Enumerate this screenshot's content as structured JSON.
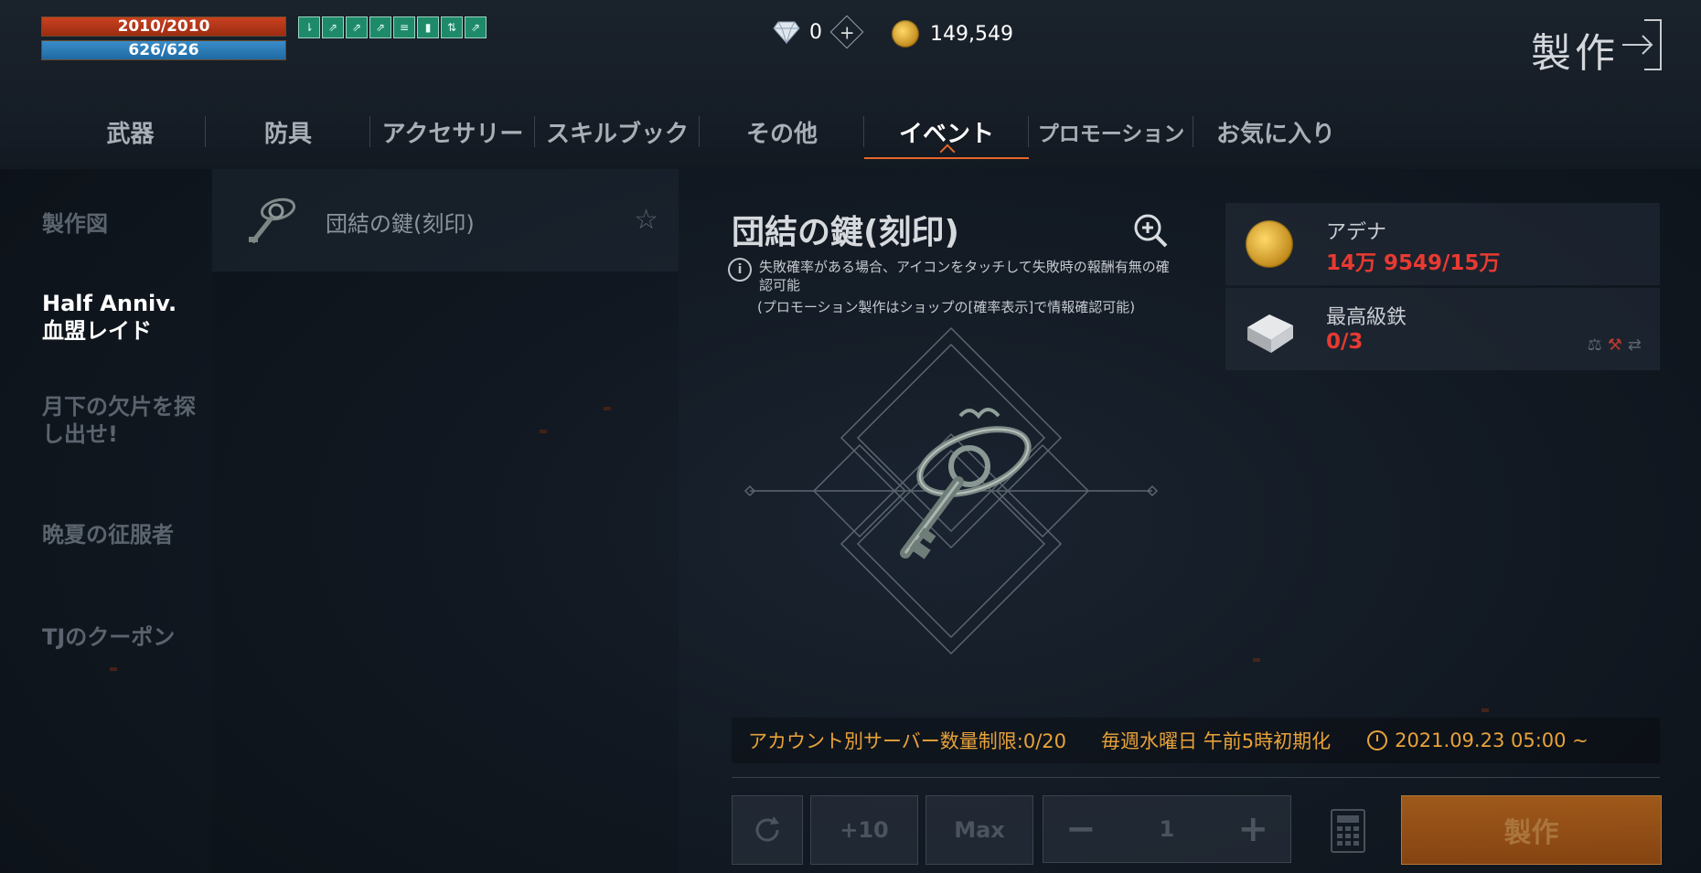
{
  "status": {
    "hp": "2010/2010",
    "mp": "626/626",
    "buffs": [
      "⇂",
      "⇗",
      "⇗",
      "⇗",
      "≡",
      "▮",
      "⇅",
      "⇗"
    ]
  },
  "currency": {
    "gems": "0",
    "adena": "149,549"
  },
  "header": {
    "title": "製作"
  },
  "tabs": [
    {
      "label": "武器"
    },
    {
      "label": "防具"
    },
    {
      "label": "アクセサリー"
    },
    {
      "label": "スキルブック"
    },
    {
      "label": "その他"
    },
    {
      "label": "イベント"
    },
    {
      "label": "プロモーション"
    },
    {
      "label": "お気に入り"
    }
  ],
  "sidebar": {
    "items": [
      {
        "label": "製作図"
      },
      {
        "label": "Half Anniv.\n血盟レイド"
      },
      {
        "label": "月下の欠片を探\nし出せ!"
      },
      {
        "label": "晩夏の征服者"
      },
      {
        "label": "TJのクーポン"
      }
    ]
  },
  "list": {
    "items": [
      {
        "name": "団結の鍵(刻印)"
      }
    ]
  },
  "detail": {
    "name": "団結の鍵(刻印)",
    "info_line1": "失敗確率がある場合、アイコンをタッチして失敗時の報酬有無の確認可能",
    "info_line2": "(プロモーション製作はショップの[確率表示]で情報確認可能)"
  },
  "materials": [
    {
      "name": "アデナ",
      "value": "14万 9549/15万",
      "icon": "coin-icon"
    },
    {
      "name": "最高級鉄",
      "value": "0/3",
      "icon": "iron-ingot-icon"
    }
  ],
  "limits": {
    "account": "アカウント別サーバー数量制限:0/20",
    "reset": "毎週水曜日 午前5時初期化",
    "date": "2021.09.23 05:00 ~"
  },
  "controls": {
    "plus10": "+10",
    "max": "Max",
    "minus": "−",
    "quantity": "1",
    "plus": "+",
    "craft": "製作"
  },
  "colors": {
    "accent": "#e8652a",
    "warning": "#e8a23a",
    "insufficient": "#e83a32"
  }
}
